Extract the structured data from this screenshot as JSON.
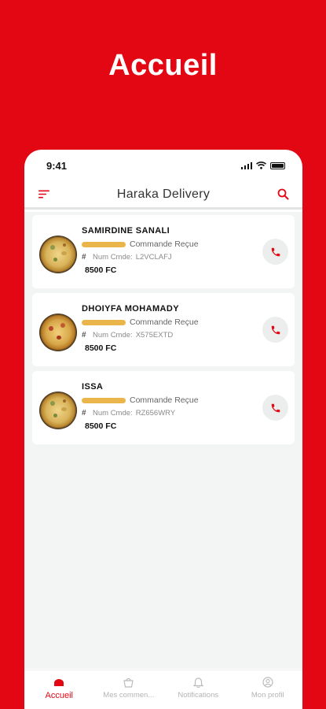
{
  "promo": {
    "title": "Accueil"
  },
  "status_bar": {
    "time": "9:41"
  },
  "header": {
    "title": "Haraka Delivery",
    "menu_icon": "sort-menu-icon",
    "search_icon": "search-icon"
  },
  "orders": [
    {
      "customer": "SAMIRDINE SANALI",
      "status": "Commande Reçue",
      "num_label": "Num Cmde:",
      "num": "L2VCLAFJ",
      "price": "8500 FC"
    },
    {
      "customer": "DHOIYFA MOHAMADY",
      "status": "Commande Reçue",
      "num_label": "Num Cmde:",
      "num": "X575EXTD",
      "price": "8500 FC"
    },
    {
      "customer": "ISSA",
      "status": "Commande Reçue",
      "num_label": "Num Cmde:",
      "num": "RZ656WRY",
      "price": "8500 FC"
    }
  ],
  "nav": {
    "items": [
      {
        "label": "Accueil",
        "icon": "home-icon",
        "active": true
      },
      {
        "label": "Mes commen...",
        "icon": "basket-icon",
        "active": false
      },
      {
        "label": "Notifications",
        "icon": "bell-icon",
        "active": false
      },
      {
        "label": "Mon profil",
        "icon": "profile-icon",
        "active": false
      }
    ]
  },
  "colors": {
    "brand": "#e30613",
    "status_pill": "#eab54a",
    "background": "#f3f5f4"
  }
}
